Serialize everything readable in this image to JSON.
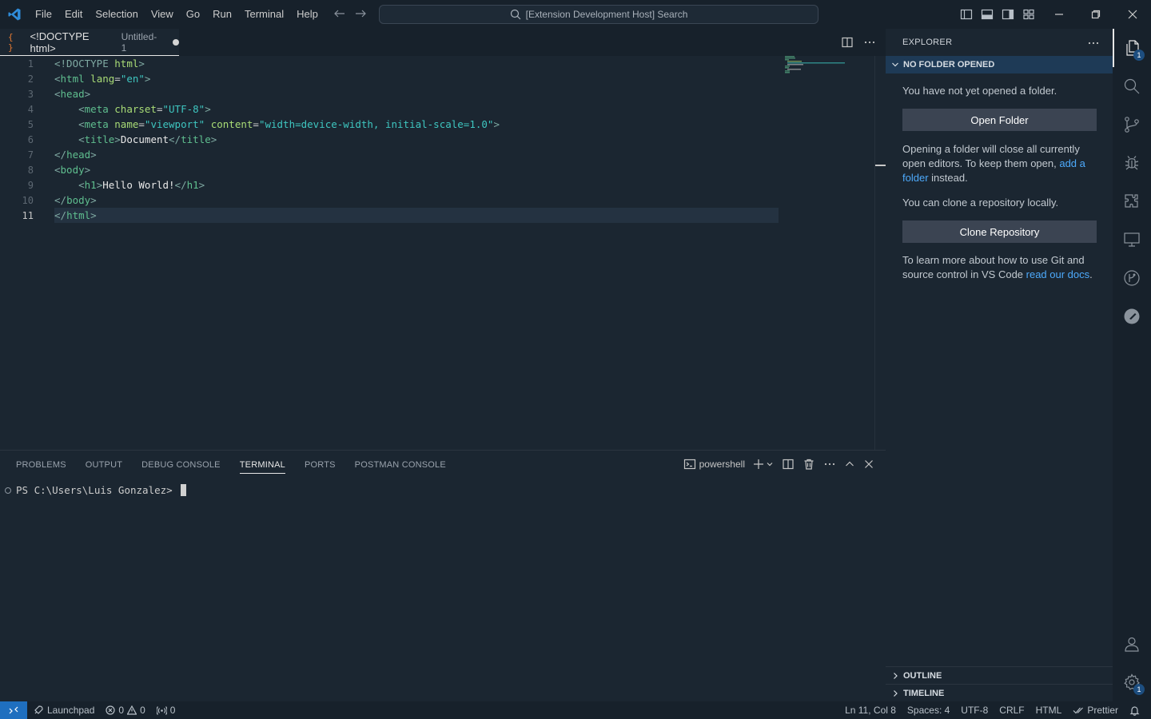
{
  "titlebar": {
    "menu": [
      "File",
      "Edit",
      "Selection",
      "View",
      "Go",
      "Run",
      "Terminal",
      "Help"
    ],
    "search_text": "[Extension Development Host] Search"
  },
  "tab": {
    "icon": "{ }",
    "title": "<!DOCTYPE html>",
    "description": "Untitled-1"
  },
  "editor": {
    "current_line": 11,
    "lines": [
      [
        "1",
        "<!DOCTYPE html>"
      ],
      [
        "2",
        "<html lang=\"en\">"
      ],
      [
        "3",
        "<head>"
      ],
      [
        "4",
        "    <meta charset=\"UTF-8\">"
      ],
      [
        "5",
        "    <meta name=\"viewport\" content=\"width=device-width, initial-scale=1.0\">"
      ],
      [
        "6",
        "    <title>Document</title>"
      ],
      [
        "7",
        "</head>"
      ],
      [
        "8",
        "<body>"
      ],
      [
        "9",
        "    <h1>Hello World!</h1>"
      ],
      [
        "10",
        "</body>"
      ],
      [
        "11",
        "</html>"
      ]
    ]
  },
  "panel": {
    "tabs": [
      "PROBLEMS",
      "OUTPUT",
      "DEBUG CONSOLE",
      "TERMINAL",
      "PORTS",
      "POSTMAN CONSOLE"
    ],
    "active_tab": "TERMINAL",
    "shell": "powershell",
    "prompt": "PS C:\\Users\\Luis Gonzalez>"
  },
  "sidebar": {
    "header": "EXPLORER",
    "section_title": "NO FOLDER OPENED",
    "no_folder_text": "You have not yet opened a folder.",
    "open_folder_label": "Open Folder",
    "info_text_before": "Opening a folder will close all currently open editors. To keep them open, ",
    "info_link": "add a folder",
    "info_text_after": " instead.",
    "clone_text": "You can clone a repository locally.",
    "clone_label": "Clone Repository",
    "learn_before": "To learn more about how to use Git and source control in VS Code ",
    "learn_link": "read our docs",
    "learn_after": ".",
    "outline_label": "OUTLINE",
    "timeline_label": "TIMELINE"
  },
  "activitybar": {
    "explorer_badge": "1",
    "settings_badge": "1"
  },
  "statusbar": {
    "launchpad": "Launchpad",
    "errors": "0",
    "warnings": "0",
    "ports": "0",
    "position": "Ln 11, Col 8",
    "spaces": "Spaces: 4",
    "encoding": "UTF-8",
    "eol": "CRLF",
    "language": "HTML",
    "formatter": "Prettier"
  },
  "colors": {
    "background": "#1b2631",
    "chrome": "#17212b",
    "accent": "#1f6fbf",
    "link": "#4daafc"
  }
}
